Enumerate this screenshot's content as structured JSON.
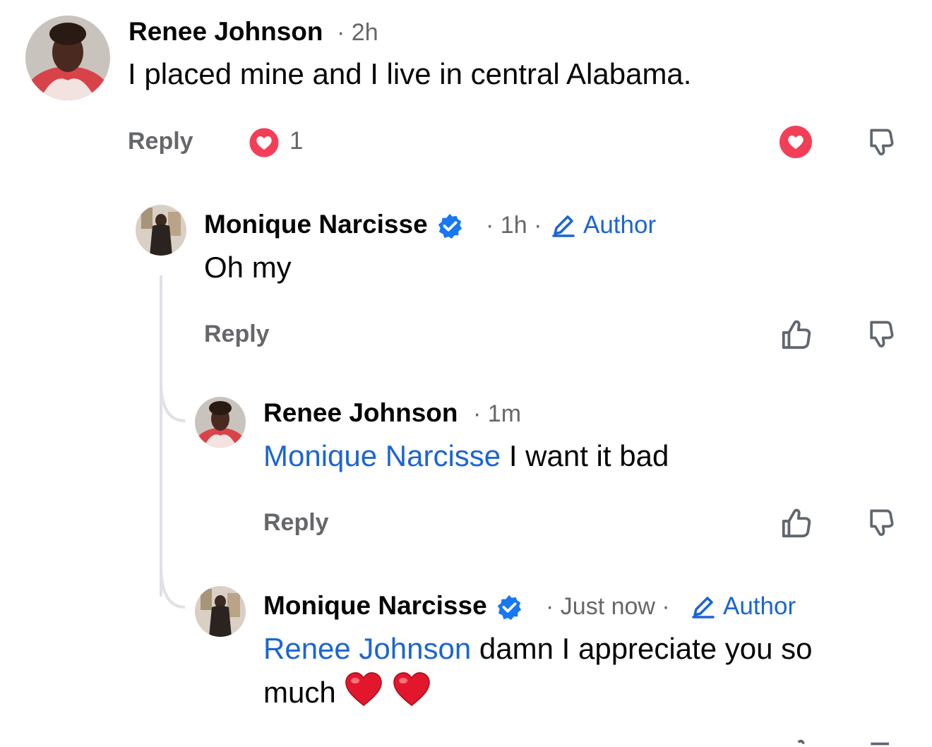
{
  "comments": [
    {
      "author": "Renee Johnson",
      "time": "2h",
      "text": "I placed mine and I live in central Alabama.",
      "reply_label": "Reply",
      "reaction_count": "1"
    },
    {
      "author": "Monique Narcisse",
      "time": "1h",
      "author_badge": "Author",
      "text": "Oh my",
      "reply_label": "Reply"
    },
    {
      "author": "Renee Johnson",
      "time": "1m",
      "mention": "Monique Narcisse",
      "text": "I want it bad",
      "reply_label": "Reply"
    },
    {
      "author": "Monique Narcisse",
      "time": "Just now",
      "author_badge": "Author",
      "mention": "Renee Johnson",
      "text_line1": "damn I appreciate you so",
      "text_line2": "much"
    }
  ],
  "separator": "·",
  "icons": {
    "love": "love-reaction-icon",
    "like": "thumbs-up-icon",
    "dislike": "thumbs-down-icon",
    "verified": "verified-badge-icon",
    "pencil": "pencil-icon",
    "heart_emoji": "red-heart-emoji"
  },
  "colors": {
    "mention": "#1b65d4",
    "secondary_text": "#65676b",
    "love_red": "#f33e58",
    "thread_line": "#dfe1e5"
  }
}
